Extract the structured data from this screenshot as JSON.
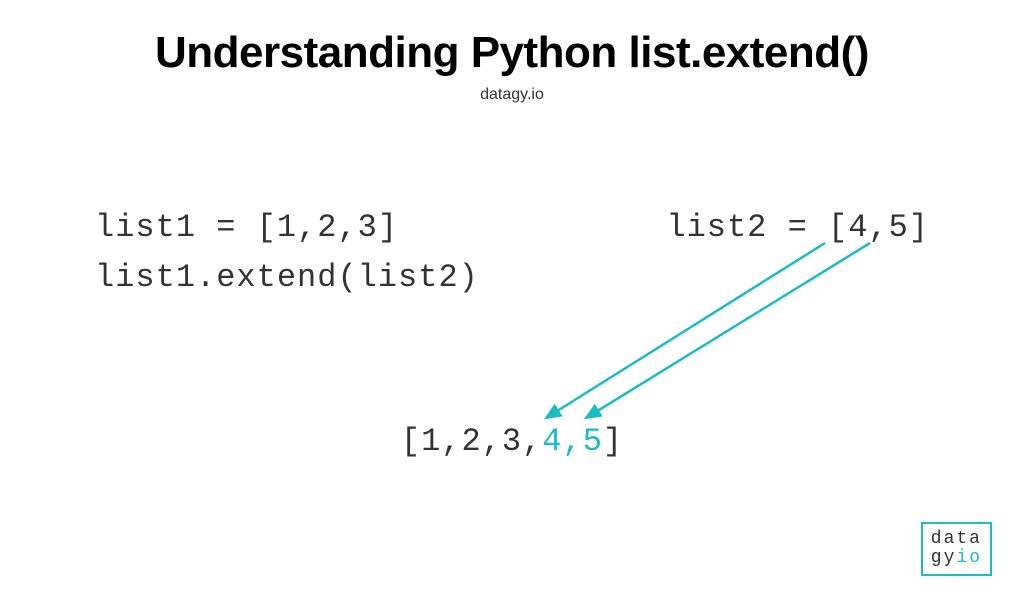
{
  "header": {
    "title": "Understanding Python list.extend()",
    "subtitle": "datagy.io"
  },
  "code": {
    "line1_left": "list1 = [1,2,3]",
    "line1_right": "list2 = [4,5]",
    "line2": "list1.extend(list2)"
  },
  "result": {
    "prefix": "[1,2,3,",
    "highlight": "4,5",
    "suffix": "]"
  },
  "logo": {
    "line1": "data",
    "line2_prefix": "gy",
    "line2_suffix": "io"
  },
  "diagram": {
    "accent_color": "#1bbbc4",
    "arrows": [
      {
        "from_element": "list2-item-4",
        "to_element": "result-item-4"
      },
      {
        "from_element": "list2-item-5",
        "to_element": "result-item-5"
      }
    ]
  }
}
